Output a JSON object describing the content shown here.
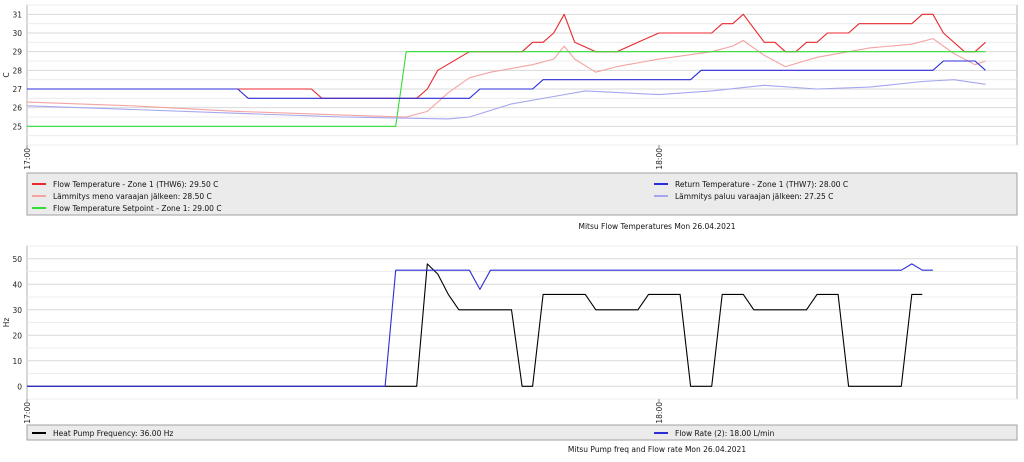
{
  "chart_data": [
    {
      "type": "line",
      "title": "Mitsu Flow Temperatures Mon 26.04.2021",
      "ylabel": "C",
      "xlabel": "",
      "x_ticks": [
        "17:00",
        "18:00"
      ],
      "x_range": [
        "17:00",
        "18:30"
      ],
      "ylim": [
        24,
        31.5
      ],
      "y_ticks": [
        25,
        26,
        27,
        28,
        29,
        30,
        31
      ],
      "grid": true,
      "legend_position": "bottom",
      "series": [
        {
          "name": "Flow Temperature - Zone 1 (THW6): 29.50 C",
          "color": "#e8292e",
          "points": [
            [
              "17:00",
              27.0
            ],
            [
              "17:20",
              27.0
            ],
            [
              "17:27",
              27.0
            ],
            [
              "17:28",
              26.5
            ],
            [
              "17:35",
              26.5
            ],
            [
              "17:37",
              26.5
            ],
            [
              "17:38",
              27.0
            ],
            [
              "17:39",
              28.0
            ],
            [
              "17:42",
              29.0
            ],
            [
              "17:47",
              29.0
            ],
            [
              "17:48",
              29.5
            ],
            [
              "17:49",
              29.5
            ],
            [
              "17:50",
              30.0
            ],
            [
              "17:51",
              31.0
            ],
            [
              "17:52",
              29.5
            ],
            [
              "17:54",
              29.0
            ],
            [
              "17:56",
              29.0
            ],
            [
              "17:58",
              29.5
            ],
            [
              "18:00",
              30.0
            ],
            [
              "18:05",
              30.0
            ],
            [
              "18:06",
              30.5
            ],
            [
              "18:07",
              30.5
            ],
            [
              "18:08",
              31.0
            ],
            [
              "18:10",
              29.5
            ],
            [
              "18:11",
              29.5
            ],
            [
              "18:12",
              29.0
            ],
            [
              "18:13",
              29.0
            ],
            [
              "18:14",
              29.5
            ],
            [
              "18:15",
              29.5
            ],
            [
              "18:16",
              30.0
            ],
            [
              "18:18",
              30.0
            ],
            [
              "18:19",
              30.5
            ],
            [
              "18:24",
              30.5
            ],
            [
              "18:25",
              31.0
            ],
            [
              "18:26",
              31.0
            ],
            [
              "18:27",
              30.0
            ],
            [
              "18:29",
              29.0
            ],
            [
              "18:30",
              29.0
            ],
            [
              "18:31",
              29.5
            ]
          ]
        },
        {
          "name": "Lämmitys meno varaajan jälkeen: 28.50 C",
          "color": "#f4a3a3",
          "points": [
            [
              "17:00",
              26.3
            ],
            [
              "17:10",
              26.1
            ],
            [
              "17:20",
              25.8
            ],
            [
              "17:30",
              25.6
            ],
            [
              "17:36",
              25.5
            ],
            [
              "17:38",
              25.8
            ],
            [
              "17:40",
              26.8
            ],
            [
              "17:42",
              27.6
            ],
            [
              "17:44",
              27.9
            ],
            [
              "17:48",
              28.3
            ],
            [
              "17:50",
              28.6
            ],
            [
              "17:51",
              29.3
            ],
            [
              "17:52",
              28.6
            ],
            [
              "17:54",
              27.9
            ],
            [
              "17:56",
              28.2
            ],
            [
              "18:00",
              28.6
            ],
            [
              "18:05",
              29.0
            ],
            [
              "18:07",
              29.3
            ],
            [
              "18:08",
              29.6
            ],
            [
              "18:10",
              28.8
            ],
            [
              "18:12",
              28.2
            ],
            [
              "18:15",
              28.7
            ],
            [
              "18:20",
              29.2
            ],
            [
              "18:24",
              29.4
            ],
            [
              "18:26",
              29.7
            ],
            [
              "18:28",
              28.9
            ],
            [
              "18:30",
              28.3
            ],
            [
              "18:31",
              28.5
            ]
          ]
        },
        {
          "name": "Flow Temperature Setpoint - Zone 1: 29.00 C",
          "color": "#33dd33",
          "points": [
            [
              "17:00",
              25.0
            ],
            [
              "17:35",
              25.0
            ],
            [
              "17:36",
              29.0
            ],
            [
              "18:31",
              29.0
            ]
          ]
        },
        {
          "name": "Return Temperature - Zone 1 (THW7): 28.00 C",
          "color": "#2c2cd8",
          "points": [
            [
              "17:00",
              27.0
            ],
            [
              "17:20",
              27.0
            ],
            [
              "17:21",
              26.5
            ],
            [
              "17:42",
              26.5
            ],
            [
              "17:43",
              27.0
            ],
            [
              "17:48",
              27.0
            ],
            [
              "17:49",
              27.5
            ],
            [
              "18:03",
              27.5
            ],
            [
              "18:04",
              28.0
            ],
            [
              "18:26",
              28.0
            ],
            [
              "18:27",
              28.5
            ],
            [
              "18:30",
              28.5
            ],
            [
              "18:31",
              28.0
            ]
          ]
        },
        {
          "name": "Lämmitys paluu varaajan jälkeen: 27.25 C",
          "color": "#a6a6f0",
          "points": [
            [
              "17:00",
              26.1
            ],
            [
              "17:10",
              25.9
            ],
            [
              "17:20",
              25.7
            ],
            [
              "17:30",
              25.5
            ],
            [
              "17:40",
              25.4
            ],
            [
              "17:42",
              25.5
            ],
            [
              "17:46",
              26.2
            ],
            [
              "17:50",
              26.6
            ],
            [
              "17:53",
              26.9
            ],
            [
              "18:00",
              26.7
            ],
            [
              "18:05",
              26.9
            ],
            [
              "18:10",
              27.2
            ],
            [
              "18:15",
              27.0
            ],
            [
              "18:20",
              27.1
            ],
            [
              "18:25",
              27.4
            ],
            [
              "18:28",
              27.5
            ],
            [
              "18:31",
              27.25
            ]
          ]
        }
      ]
    },
    {
      "type": "line",
      "title": "Mitsu Pump freq and Flow rate Mon 26.04.2021",
      "ylabel": "Hz",
      "xlabel": "",
      "x_ticks": [
        "17:00",
        "18:00"
      ],
      "x_range": [
        "17:00",
        "18:30"
      ],
      "ylim": [
        -5,
        55
      ],
      "y_ticks": [
        0,
        10,
        20,
        30,
        40,
        50
      ],
      "grid": true,
      "legend_position": "bottom",
      "series": [
        {
          "name": "Heat Pump Frequency: 36.00 Hz",
          "color": "#000000",
          "points": [
            [
              "17:00",
              0
            ],
            [
              "17:37",
              0
            ],
            [
              "17:38",
              48
            ],
            [
              "17:39",
              44
            ],
            [
              "17:40",
              36
            ],
            [
              "17:41",
              30
            ],
            [
              "17:46",
              30
            ],
            [
              "17:47",
              0
            ],
            [
              "17:48",
              0
            ],
            [
              "17:49",
              36
            ],
            [
              "17:53",
              36
            ],
            [
              "17:54",
              30
            ],
            [
              "17:58",
              30
            ],
            [
              "17:59",
              36
            ],
            [
              "18:02",
              36
            ],
            [
              "18:03",
              0
            ],
            [
              "18:05",
              0
            ],
            [
              "18:06",
              36
            ],
            [
              "18:08",
              36
            ],
            [
              "18:09",
              30
            ],
            [
              "18:14",
              30
            ],
            [
              "18:15",
              36
            ],
            [
              "18:17",
              36
            ],
            [
              "18:18",
              0
            ],
            [
              "18:23",
              0
            ],
            [
              "18:24",
              36
            ],
            [
              "18:25",
              36
            ]
          ]
        },
        {
          "name": "Flow Rate (2): 18.00 L/min",
          "color": "#2c2cd8",
          "points": [
            [
              "17:00",
              0
            ],
            [
              "17:34",
              0
            ],
            [
              "17:35",
              45.5
            ],
            [
              "17:42",
              45.5
            ],
            [
              "17:43",
              38
            ],
            [
              "17:44",
              45.5
            ],
            [
              "18:23",
              45.5
            ],
            [
              "18:24",
              48
            ],
            [
              "18:25",
              45.5
            ],
            [
              "18:26",
              45.5
            ]
          ]
        }
      ]
    }
  ]
}
